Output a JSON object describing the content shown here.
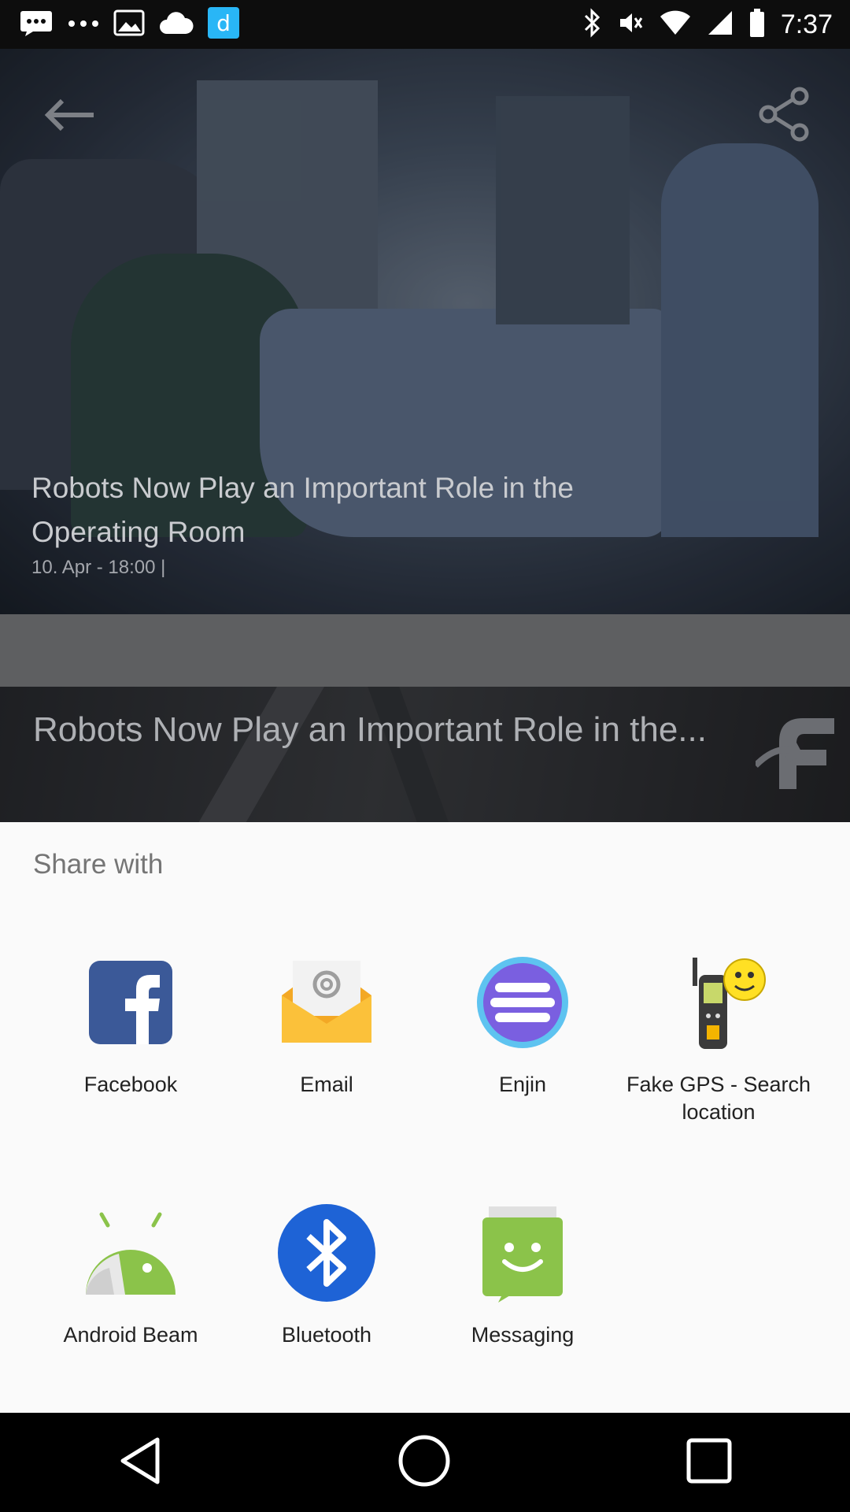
{
  "status_bar": {
    "time": "7:37",
    "icons": [
      "message-icon",
      "more-dots-icon",
      "photo-icon",
      "cloud-icon",
      "dictionary-app-icon",
      "bluetooth-icon",
      "mute-icon",
      "wifi-icon",
      "signal-icon",
      "battery-icon"
    ]
  },
  "article": {
    "title": "Robots Now Play an Important Role in the Operating Room",
    "meta": "10. Apr - 18:00  |",
    "banner_title": "Robots Now Play an Important Role in the..."
  },
  "share_sheet": {
    "title": "Share with",
    "apps": [
      {
        "label": "Facebook",
        "icon": "facebook-icon"
      },
      {
        "label": "Email",
        "icon": "email-icon"
      },
      {
        "label": "Enjin",
        "icon": "enjin-icon"
      },
      {
        "label": "Fake GPS - Search location",
        "icon": "fake-gps-icon"
      },
      {
        "label": "Android Beam",
        "icon": "android-beam-icon"
      },
      {
        "label": "Bluetooth",
        "icon": "bluetooth-icon"
      },
      {
        "label": "Messaging",
        "icon": "messaging-icon"
      }
    ]
  },
  "nav_bar": {
    "icons": [
      "back-icon",
      "home-icon",
      "recents-icon"
    ]
  },
  "colors": {
    "sheet_background": "#fafafa",
    "facebook_blue": "#3b5998",
    "bluetooth_blue": "#1e63d6",
    "android_green": "#8bc34a"
  }
}
